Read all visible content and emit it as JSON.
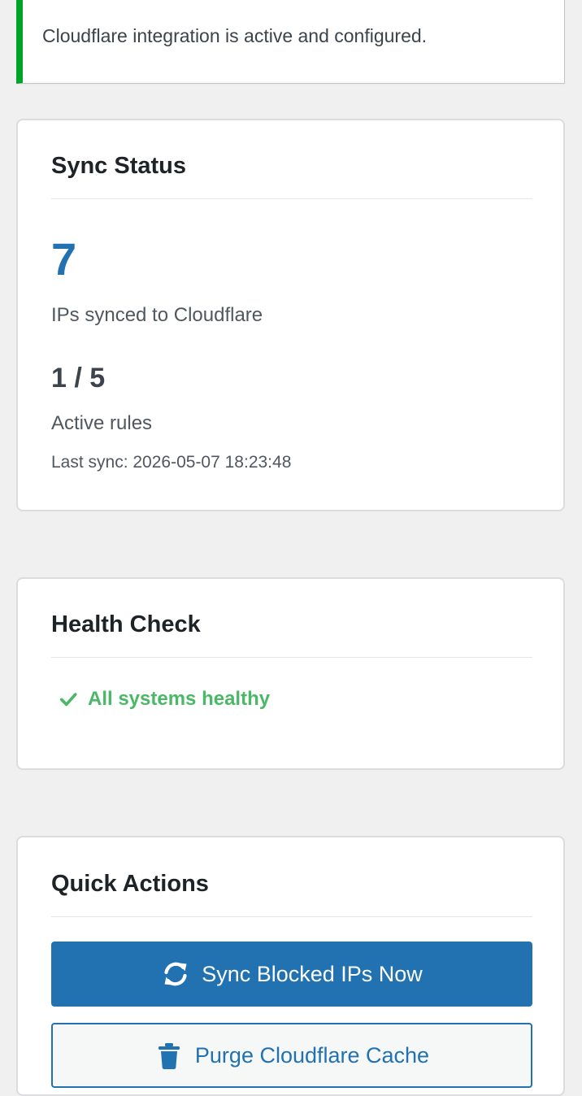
{
  "notice": {
    "text": "Cloudflare integration is active and configured."
  },
  "sync_status": {
    "title": "Sync Status",
    "ips_synced_count": "7",
    "ips_synced_label": "IPs synced to Cloudflare",
    "active_rules_value": "1 / 5",
    "active_rules_label": "Active rules",
    "last_sync": "Last sync: 2026-05-07 18:23:48"
  },
  "health_check": {
    "title": "Health Check",
    "status_text": "All systems healthy",
    "status_icon": "checkmark-icon"
  },
  "quick_actions": {
    "title": "Quick Actions",
    "sync_button_label": "Sync Blocked IPs Now",
    "sync_button_icon": "sync-icon",
    "purge_button_label": "Purge Cloudflare Cache",
    "purge_button_icon": "trash-icon"
  },
  "colors": {
    "success": "#00a32a",
    "healthy_text": "#4ab866",
    "primary": "#2271b1"
  }
}
